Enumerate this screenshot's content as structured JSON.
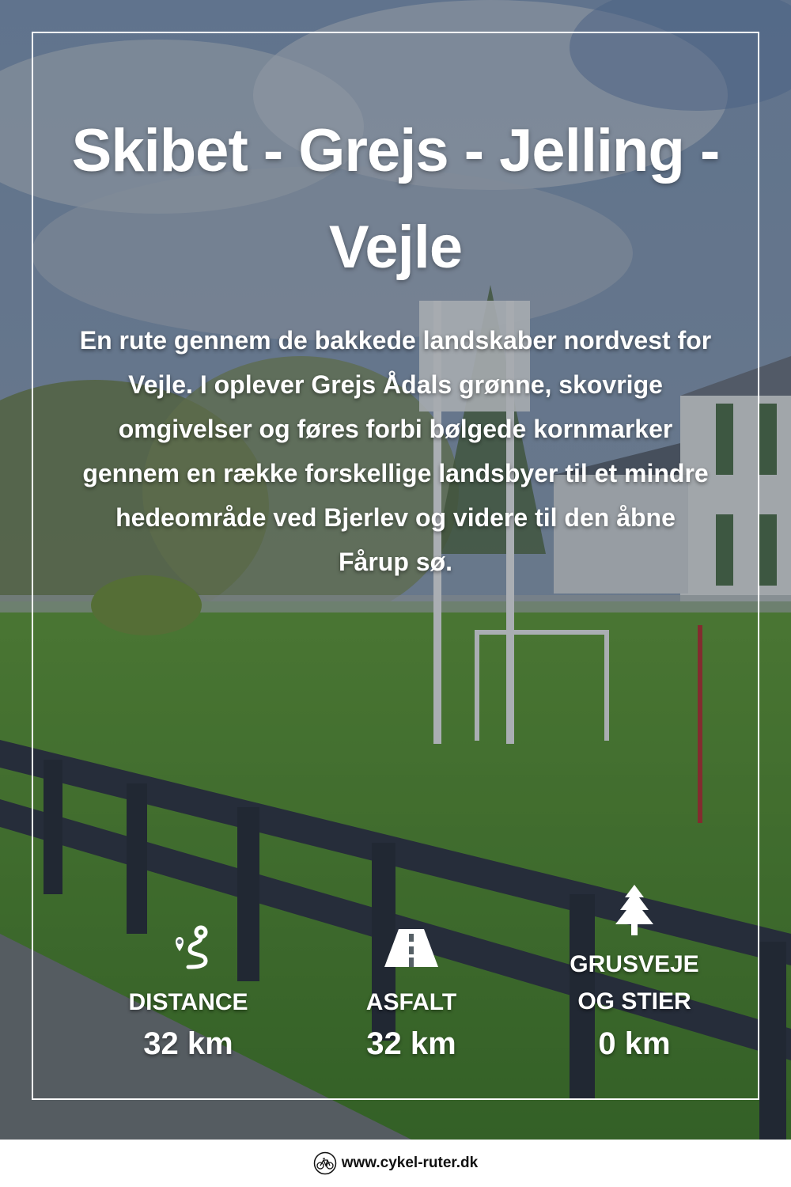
{
  "title": "Skibet - Grejs - Jelling - Vejle",
  "description": "En rute gennem de bakkede landskaber nordvest for Vejle. I oplever Grejs Ådals grønne, skovrige omgivelser og føres forbi bølgede kornmarker gennem en række forskellige landsbyer til et mindre hedeområde ved Bjerlev og videre til den åbne Fårup sø.",
  "stats": [
    {
      "icon": "route-icon",
      "label": "DISTANCE",
      "value": "32 km"
    },
    {
      "icon": "road-icon",
      "label": "ASFALT",
      "value": "32 km"
    },
    {
      "icon": "tree-icon",
      "label_line1": "GRUSVEJE",
      "label_line2": "OG STIER",
      "value": "0 km"
    }
  ],
  "footer": {
    "icon": "bicycle-logo-icon",
    "url": "www.cykel-ruter.dk"
  },
  "colors": {
    "text": "#ffffff",
    "sky": "#6f86a6",
    "grass": "#4f8a2c",
    "fence": "#2a2f3a"
  }
}
